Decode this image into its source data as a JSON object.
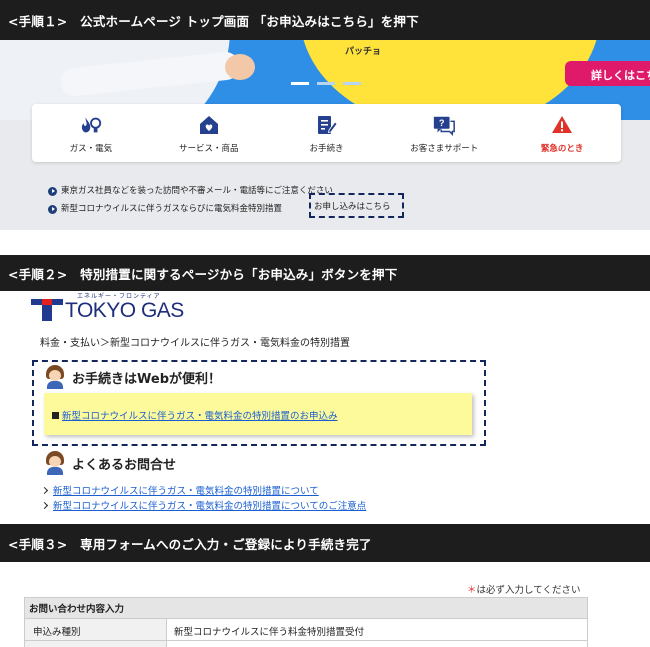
{
  "step1": {
    "title": "<手順１>　公式ホームページ トップ画面 「お申込みはこちら」を押下"
  },
  "hero": {
    "banner_text": "パッチョ",
    "more_button": "詳しくはこち"
  },
  "menu": {
    "items": [
      {
        "label": "ガス・電気",
        "icon": "gas-electric-icon"
      },
      {
        "label": "サービス・商品",
        "icon": "home-icon"
      },
      {
        "label": "お手続き",
        "icon": "form-edit-icon"
      },
      {
        "label": "お客さまサポート",
        "icon": "chat-question-icon"
      },
      {
        "label": "緊急のとき",
        "icon": "warning-icon"
      }
    ]
  },
  "notices": [
    "東京ガス社員などを装った訪問や不審メール・電話等にご注意ください",
    "新型コロナウイルスに伴うガスならびに電気料金特別措置"
  ],
  "apply_link": "お申し込みはこちら",
  "step2": {
    "title": "<手順２>　特別措置に関するページから「お申込み」ボタンを押下"
  },
  "logo": {
    "text": "TOKYO GAS",
    "sub": "エネルギー・フロンティア"
  },
  "breadcrumb": "料金・支払い＞新型コロナウイルスに伴うガス・電気料金の特別措置",
  "web_section": {
    "heading": "お手続きはWebが便利！",
    "link": "新型コロナウイルスに伴うガス・電気料金の特別措置のお申込み"
  },
  "faq": {
    "heading": "よくあるお問合せ",
    "links": [
      "新型コロナウイルスに伴うガス・電気料金の特別措置について",
      "新型コロナウイルスに伴うガス・電気料金の特別措置についてのご注意点"
    ]
  },
  "step3": {
    "title": "<手順３>　専用フォームへのご入力・ご登録により手続き完了"
  },
  "form": {
    "required_mark": "＊",
    "required_note": "は必ず入力してください",
    "section_title": "お問い合わせ内容入力",
    "rows": [
      {
        "label": "申込み種別",
        "value": "新型コロナウイルスに伴う料金特別措置受付"
      }
    ]
  }
}
